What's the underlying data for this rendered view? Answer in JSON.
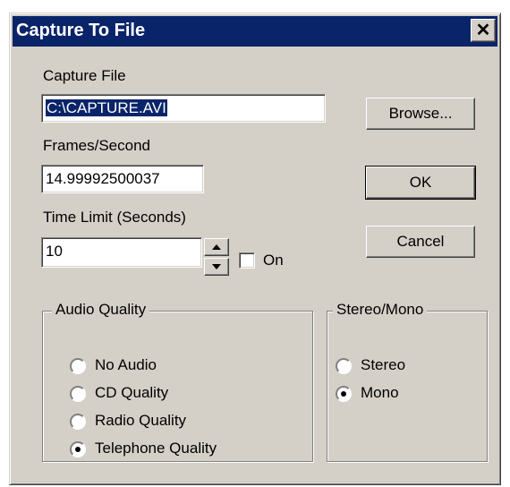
{
  "window": {
    "title": "Capture To File",
    "close_glyph": "✕"
  },
  "capture_file": {
    "label": "Capture File",
    "value": "C:\\CAPTURE.AVI"
  },
  "frames": {
    "label": "Frames/Second",
    "value": "14.99992500037"
  },
  "time_limit": {
    "label": "Time Limit (Seconds)",
    "value": "10",
    "on_label": "On",
    "on_checked": false
  },
  "buttons": {
    "browse": "Browse...",
    "ok": "OK",
    "cancel": "Cancel"
  },
  "audio_quality": {
    "title": "Audio Quality",
    "options": [
      "No Audio",
      "CD Quality",
      "Radio Quality",
      "Telephone Quality"
    ],
    "selected": "Telephone Quality"
  },
  "stereo_mono": {
    "title": "Stereo/Mono",
    "options": [
      "Stereo",
      "Mono"
    ],
    "selected": "Mono"
  },
  "colors": {
    "title_bar": "#0a246a",
    "face": "#d4d0c8",
    "selection": "#0a246a"
  }
}
